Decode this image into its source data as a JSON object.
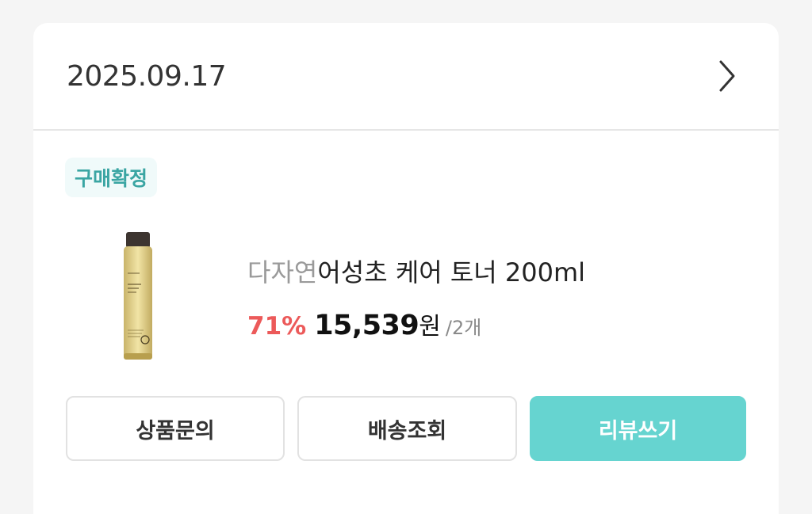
{
  "order": {
    "date": "2025.09.17",
    "status": "구매확정"
  },
  "product": {
    "brand": "다자연",
    "name": "어성초 케어 토너 200ml",
    "discount": "71%",
    "price": "15,539",
    "currency": "원",
    "quantity": "/2개",
    "image_icon": "toner-bottle-image"
  },
  "actions": {
    "inquiry_label": "상품문의",
    "tracking_label": "배송조회",
    "review_label": "리뷰쓰기"
  },
  "colors": {
    "accent": "#66d4d0",
    "status_text": "#3aa5a3",
    "discount": "#ec5a5a"
  }
}
